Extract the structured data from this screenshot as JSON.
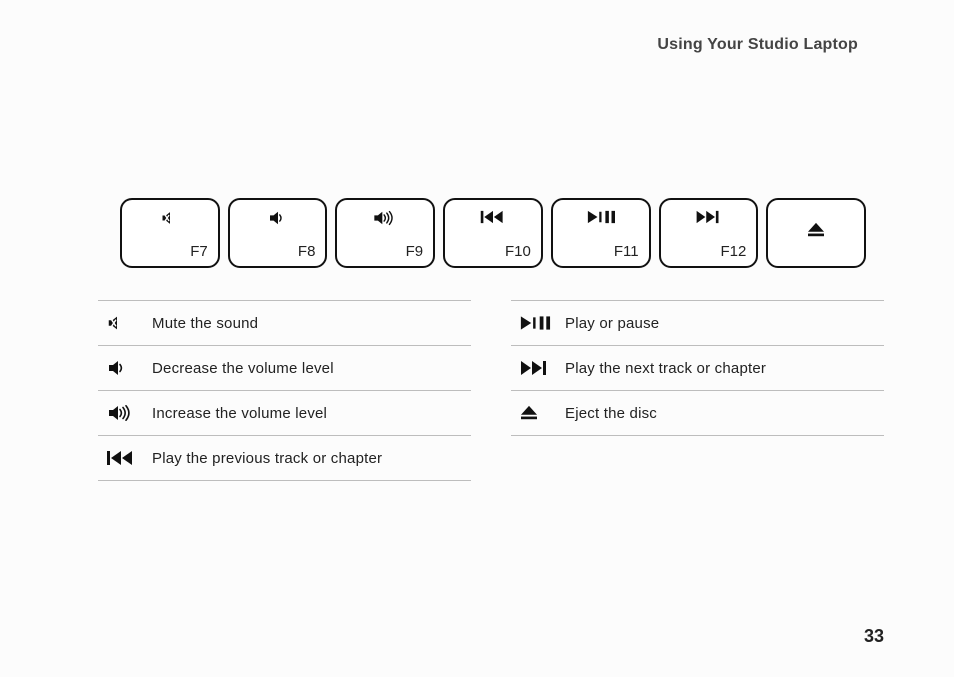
{
  "header": {
    "title": "Using Your Studio Laptop"
  },
  "keys": [
    {
      "label": "F7",
      "icon": "mute-icon"
    },
    {
      "label": "F8",
      "icon": "volume-down-icon"
    },
    {
      "label": "F9",
      "icon": "volume-up-icon"
    },
    {
      "label": "F10",
      "icon": "prev-track-icon"
    },
    {
      "label": "F11",
      "icon": "play-pause-icon"
    },
    {
      "label": "F12",
      "icon": "next-track-icon"
    },
    {
      "label": "",
      "icon": "eject-icon"
    }
  ],
  "legend_left": [
    {
      "icon": "mute-icon",
      "text": "Mute the sound"
    },
    {
      "icon": "volume-down-icon",
      "text": "Decrease the volume level"
    },
    {
      "icon": "volume-up-icon",
      "text": "Increase the volume level"
    },
    {
      "icon": "prev-track-icon",
      "text": "Play the previous track or chapter"
    }
  ],
  "legend_right": [
    {
      "icon": "play-pause-icon",
      "text": "Play or pause"
    },
    {
      "icon": "next-track-icon",
      "text": "Play the next track or chapter"
    },
    {
      "icon": "eject-icon",
      "text": "Eject the disc"
    }
  ],
  "page_number": "33"
}
